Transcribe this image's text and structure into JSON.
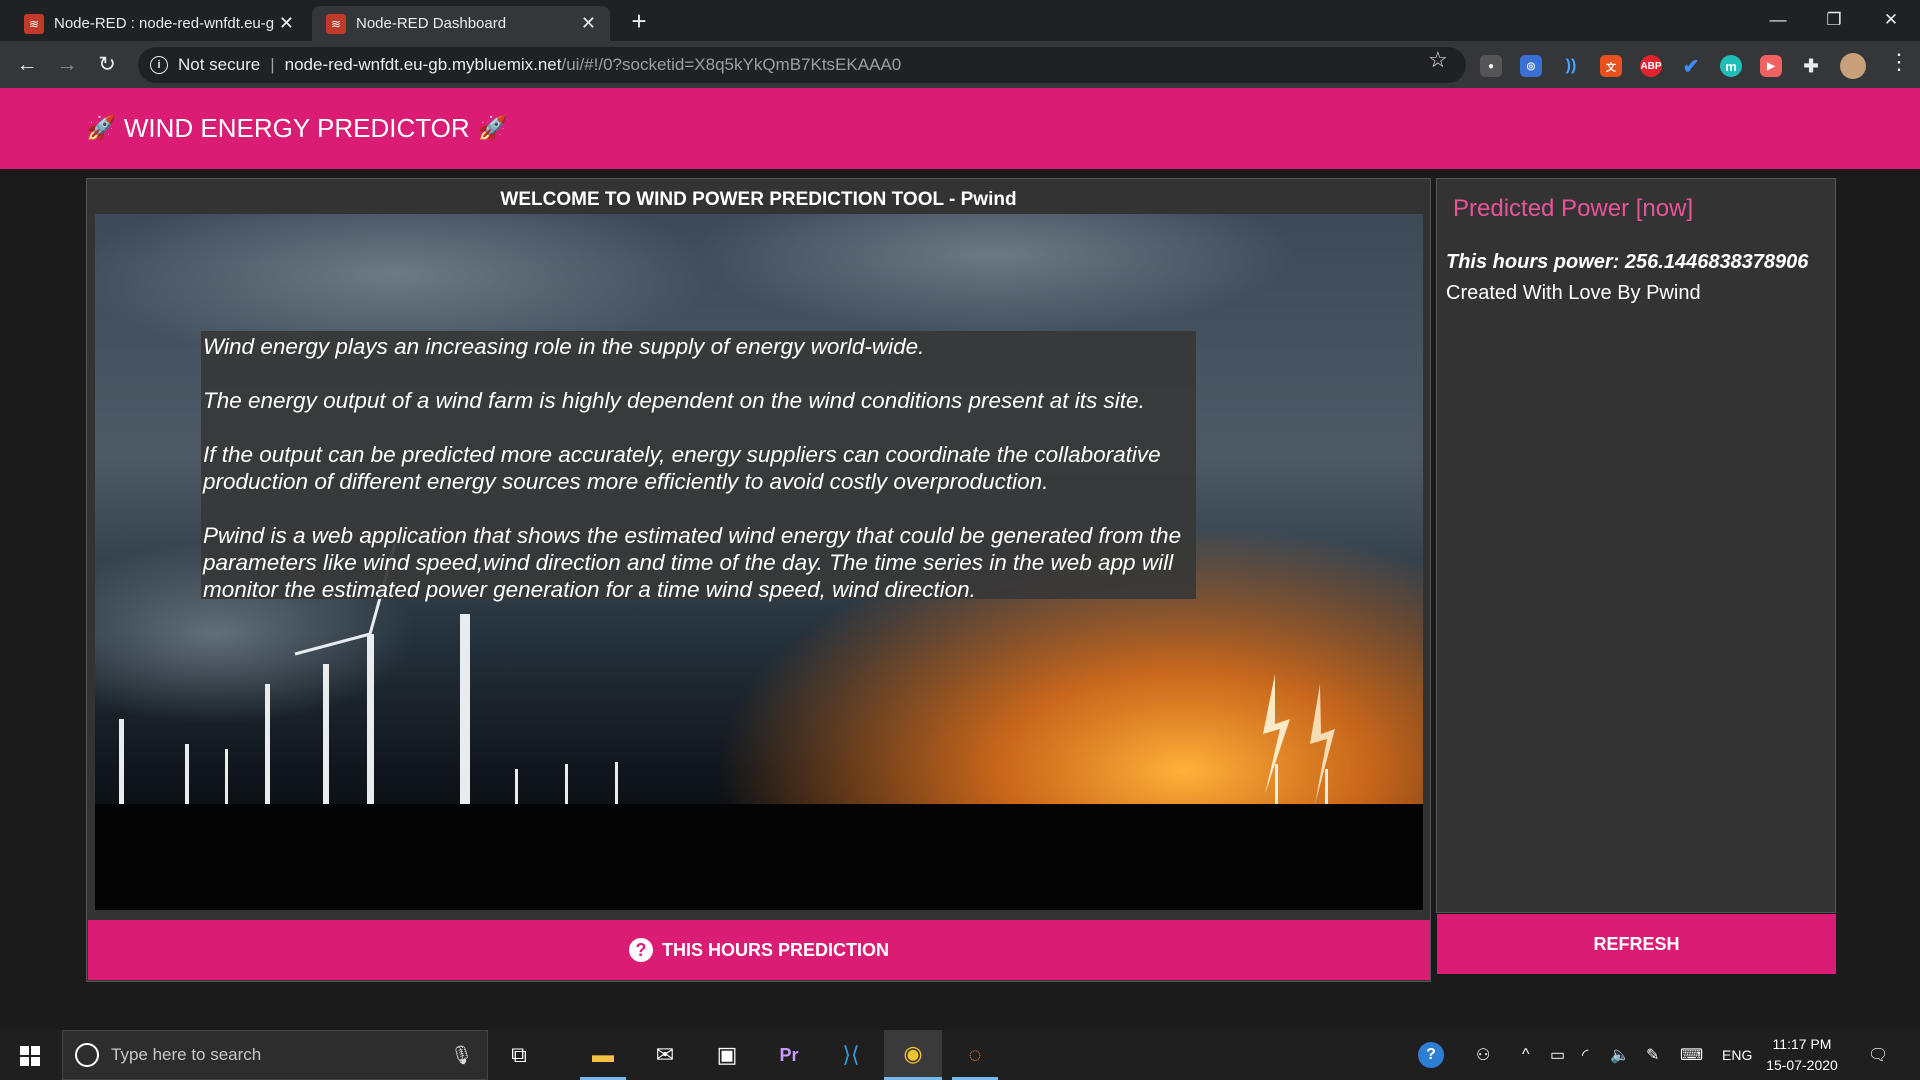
{
  "browser": {
    "tabs": [
      {
        "title": "Node-RED : node-red-wnfdt.eu-g"
      },
      {
        "title": "Node-RED Dashboard"
      }
    ],
    "security_label": "Not secure",
    "url_host": "node-red-wnfdt.eu-gb.mybluemix.net",
    "url_path": "/ui/#!/0?socketid=X8q5kYkQmB7KtsEKAAA0",
    "extensions": [
      "ABP",
      "m"
    ]
  },
  "dashboard": {
    "title": "WIND ENERGY PREDICTOR",
    "left_card": {
      "title": "WELCOME TO WIND POWER PREDICTION TOOL - Pwind",
      "paragraphs": [
        "Wind energy plays an increasing role in the supply of energy world-wide.",
        "The energy output of a wind farm is highly dependent on the wind conditions present at its site.",
        "If the output can be predicted more accurately, energy suppliers can coordinate the collaborative production of different energy sources more efficiently to avoid costly overproduction.",
        "Pwind is a web application that shows the estimated wind energy that could be generated from the parameters like wind speed,wind direction and time of the day. The time series in the web app will monitor the estimated power generation for a time wind speed, wind direction."
      ],
      "button_label": "THIS HOURS PREDICTION"
    },
    "right_card": {
      "title": "Predicted Power [now]",
      "power_text": "This hours power: 256.1446838378906",
      "created_text": "Created With Love By Pwind",
      "button_label": "REFRESH"
    },
    "colors": {
      "accent": "#da1c74",
      "card": "#333333",
      "background": "#1b1b1b"
    }
  },
  "taskbar": {
    "search_placeholder": "Type here to search",
    "language": "ENG",
    "time": "11:17 PM",
    "date": "15-07-2020"
  }
}
